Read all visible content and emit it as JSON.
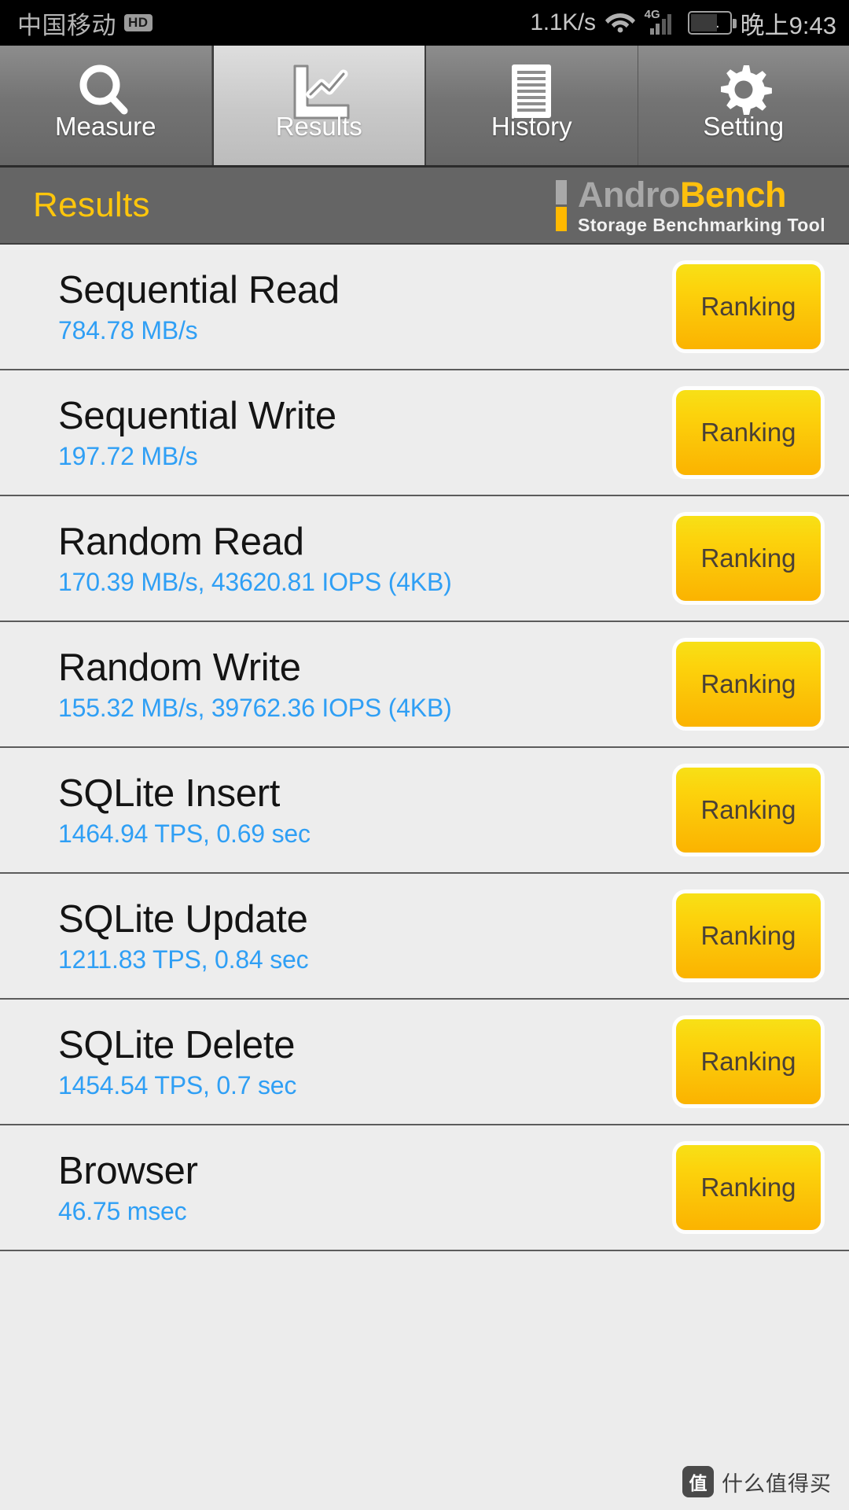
{
  "statusbar": {
    "carrier": "中国移动",
    "hd_badge": "HD",
    "net_speed": "1.1K/s",
    "network_type": "4G",
    "battery_level": "51",
    "clock": "晚上9:43"
  },
  "tabs": [
    {
      "label": "Measure",
      "icon": "search-icon",
      "active": false
    },
    {
      "label": "Results",
      "icon": "chart-icon",
      "active": true
    },
    {
      "label": "History",
      "icon": "document-icon",
      "active": false
    },
    {
      "label": "Setting",
      "icon": "gear-icon",
      "active": false
    }
  ],
  "header": {
    "title": "Results",
    "logo_first": "Andro",
    "logo_second": "Bench",
    "logo_tagline": "Storage Benchmarking Tool"
  },
  "results": [
    {
      "title": "Sequential Read",
      "value": "784.78 MB/s",
      "button": "Ranking"
    },
    {
      "title": "Sequential Write",
      "value": "197.72 MB/s",
      "button": "Ranking"
    },
    {
      "title": "Random Read",
      "value": "170.39 MB/s, 43620.81 IOPS (4KB)",
      "button": "Ranking"
    },
    {
      "title": "Random Write",
      "value": "155.32 MB/s, 39762.36 IOPS (4KB)",
      "button": "Ranking"
    },
    {
      "title": "SQLite Insert",
      "value": "1464.94 TPS, 0.69 sec",
      "button": "Ranking"
    },
    {
      "title": "SQLite Update",
      "value": "1211.83 TPS, 0.84 sec",
      "button": "Ranking"
    },
    {
      "title": "SQLite Delete",
      "value": "1454.54 TPS, 0.7 sec",
      "button": "Ranking"
    },
    {
      "title": "Browser",
      "value": "46.75 msec",
      "button": "Ranking"
    }
  ],
  "watermark": {
    "mark": "值",
    "text": "什么值得买"
  },
  "colors": {
    "accent_yellow": "#ffc60b",
    "value_blue": "#2f9ff5",
    "header_gray": "#656565",
    "list_bg": "#ededed"
  }
}
